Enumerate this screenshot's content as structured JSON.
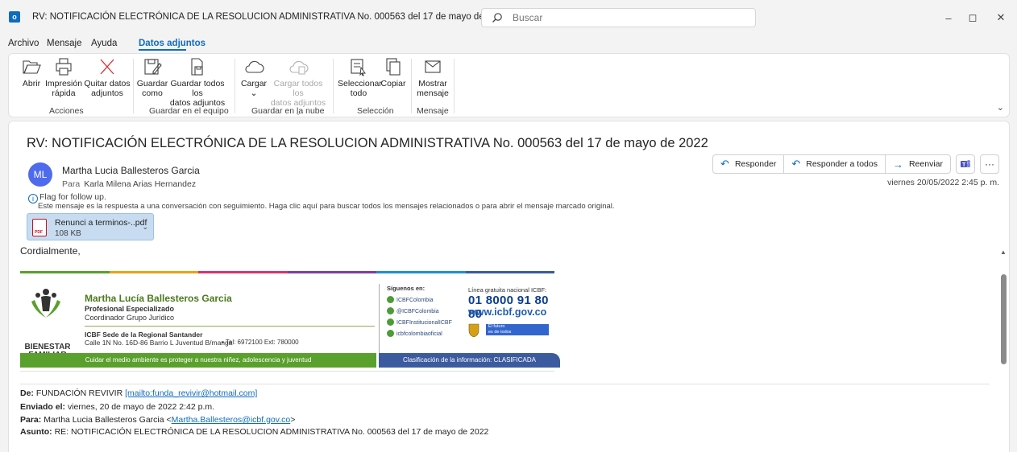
{
  "window": {
    "app_icon_label": "o",
    "title": "RV: NOTIFICACIÓN ELECTRÓNICA DE LA RESOLUCION ADMINISTRATIVA No. 000563 del 17 de mayo de 2022  -  Mensaje (HTML)",
    "search_placeholder": "Buscar",
    "controls": {
      "minimize": "–",
      "restore": "◻",
      "close": "✕"
    }
  },
  "menu": {
    "tabs": [
      {
        "label": "Archivo"
      },
      {
        "label": "Mensaje"
      },
      {
        "label": "Ayuda"
      },
      {
        "label": "Datos adjuntos",
        "active": true
      }
    ]
  },
  "ribbon": {
    "buttons": {
      "abrir": "Abrir",
      "impresion_1": "Impresión",
      "impresion_2": "rápida",
      "quitar_1": "Quitar datos",
      "quitar_2": "adjuntos",
      "guardar_1": "Guardar",
      "guardar_2": "como",
      "guardar_todos_1": "Guardar todos los",
      "guardar_todos_2": "datos adjuntos",
      "cargar_1": "Cargar",
      "cargar_2": "⌄",
      "cargar_todos_1": "Cargar todos los",
      "cargar_todos_2": "datos adjuntos ⌄",
      "seleccionar_1": "Seleccionar",
      "seleccionar_2": "todo",
      "copiar": "Copiar",
      "mostrar_1": "Mostrar",
      "mostrar_2": "mensaje"
    },
    "groups": {
      "acciones": "Acciones",
      "guardar_equipo": "Guardar en el equipo",
      "guardar_nube": "Guardar en la nube",
      "seleccion": "Selección",
      "mensaje": "Mensaje"
    }
  },
  "message": {
    "subject": "RV: NOTIFICACIÓN ELECTRÓNICA DE LA RESOLUCION ADMINISTRATIVA No. 000563 del 17 de mayo de 2022",
    "avatar_initials": "ML",
    "sender": "Martha Lucia Ballesteros Garcia",
    "to_label": "Para",
    "to": "Karla Milena Arias Hernandez",
    "flag_text": "Flag for follow up.",
    "conversation_note": "Este mensaje es la respuesta a una conversación con seguimiento. Haga clic aquí para buscar todos los mensajes relacionados o para abrir el mensaje marcado original.",
    "timestamp": "viernes 20/05/2022 2:45 p. m.",
    "actions": {
      "reply": "Responder",
      "reply_all": "Responder a todos",
      "forward": "Reenviar",
      "more": "···"
    },
    "attachment": {
      "name": "Renunci a terminos-..pdf",
      "size": "108 KB"
    },
    "greeting": "Cordialmente,"
  },
  "signature": {
    "brand_1": "BIENESTAR",
    "brand_2": "FAMILIAR",
    "name": "Martha Lucía Ballesteros Garcia",
    "role": "Profesional Especializado",
    "coord": "Coordinador Grupo Jurídico",
    "sede": "ICBF Sede de la Regional Santander",
    "address": "Calle 1N No. 16D-86 Barrio L Juventud  B/manga",
    "tel": "• Tel: 6972100 Ext: 780000",
    "follow": "Síguenos en:",
    "social": [
      "ICBFColombia",
      "@ICBFColombia",
      "ICBFInstitucionalICBF",
      "icbfcolombiaoficial"
    ],
    "linea": "Línea gratuita nacional ICBF:",
    "phone": "01 8000 91 80 80",
    "web": "www.icbf.gov.co",
    "gov_badge_1": "El futuro",
    "gov_badge_2": "es de todos",
    "gov_badge_3": "Gobierno de Colombia",
    "bar_green": "Cuidar el medio ambiente es proteger a nuestra niñez, adolescencia y juventud",
    "bar_blue": "Clasificación de la información: CLASIFICADA"
  },
  "forwarded": {
    "from_label": "De:",
    "from": "FUNDACIÓN REVIVIR ",
    "from_link": "[mailto:funda_revivir@hotmail.com]",
    "sent_label": "Enviado el:",
    "sent": "viernes, 20 de mayo de 2022 2:42 p.m.",
    "to_label": "Para:",
    "to": "Martha Lucia Ballesteros Garcia <",
    "to_link": "Martha.Ballesteros@icbf.gov.co",
    "to_end": ">",
    "subject_label": "Asunto:",
    "subject": "RE: NOTIFICACIÓN ELECTRÓNICA DE LA RESOLUCION ADMINISTRATIVA No. 000563 del 17 de mayo de 2022"
  },
  "colors": {
    "accent": "#0f6cbd",
    "green": "#5aa02c",
    "navy": "#3c5b9e",
    "avatar": "#4f6bed"
  }
}
